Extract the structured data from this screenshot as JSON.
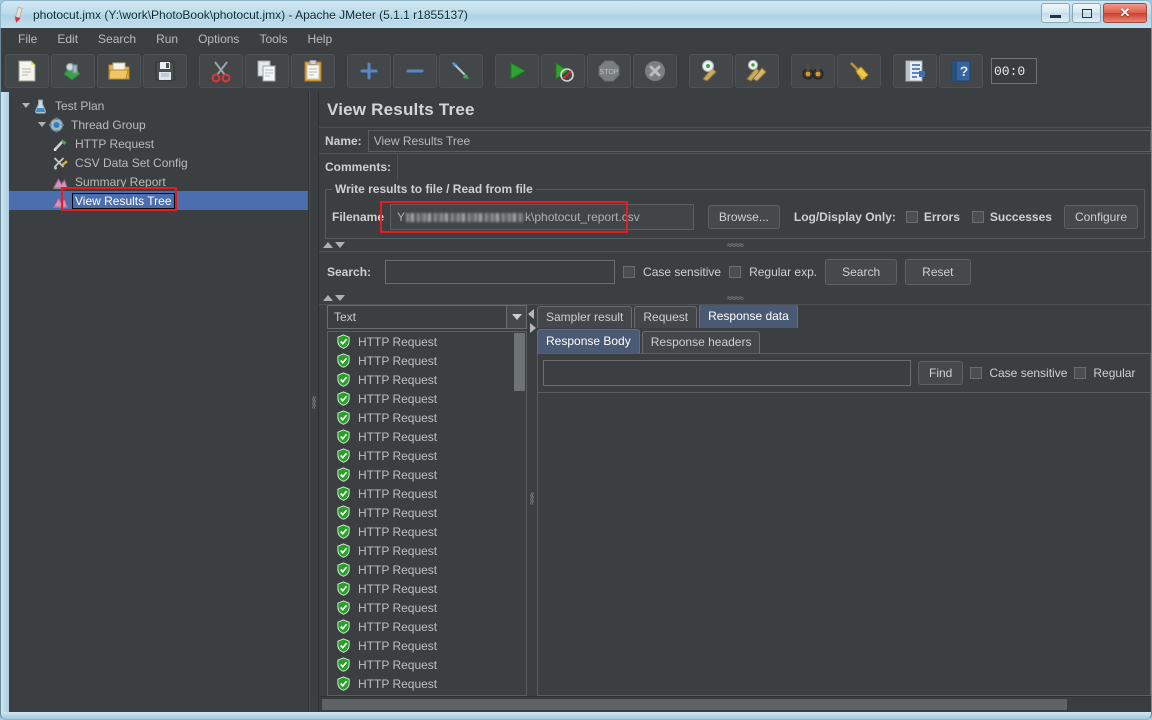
{
  "window": {
    "title": "photocut.jmx (Y:\\work\\PhotoBook\\photocut.jmx) - Apache JMeter (5.1.1 r1855137)",
    "app_icon": "jmeter-feather-icon",
    "minimize_label": "",
    "maximize_label": "",
    "close_label": "✕"
  },
  "menubar": {
    "items": [
      {
        "label": "File"
      },
      {
        "label": "Edit"
      },
      {
        "label": "Search"
      },
      {
        "label": "Run"
      },
      {
        "label": "Options"
      },
      {
        "label": "Tools"
      },
      {
        "label": "Help"
      }
    ]
  },
  "toolbar": {
    "buttons": [
      {
        "icon": "new-document-icon",
        "tooltip": "New"
      },
      {
        "icon": "templates-icon",
        "tooltip": "Templates"
      },
      {
        "icon": "open-folder-icon",
        "tooltip": "Open"
      },
      {
        "icon": "save-floppy-icon",
        "tooltip": "Save"
      },
      {
        "icon": "cut-scissors-icon",
        "tooltip": "Cut"
      },
      {
        "icon": "copy-pages-icon",
        "tooltip": "Copy"
      },
      {
        "icon": "paste-clipboard-icon",
        "tooltip": "Paste"
      },
      {
        "icon": "plus-expand-icon",
        "tooltip": "Expand all"
      },
      {
        "icon": "minus-collapse-icon",
        "tooltip": "Collapse all"
      },
      {
        "icon": "toggle-icon",
        "tooltip": "Toggle"
      },
      {
        "icon": "start-play-icon",
        "tooltip": "Start"
      },
      {
        "icon": "start-no-timers-icon",
        "tooltip": "Start no pauses"
      },
      {
        "icon": "stop-icon",
        "tooltip": "Stop"
      },
      {
        "icon": "shutdown-icon",
        "tooltip": "Shutdown"
      },
      {
        "icon": "clear-icon",
        "tooltip": "Clear"
      },
      {
        "icon": "clear-all-icon",
        "tooltip": "Clear All"
      },
      {
        "icon": "search-binoculars-icon",
        "tooltip": "Search"
      },
      {
        "icon": "reset-broom-icon",
        "tooltip": "Reset Search"
      },
      {
        "icon": "function-helper-icon",
        "tooltip": "Function Helper Dialog"
      },
      {
        "icon": "help-book-icon",
        "tooltip": "Help"
      }
    ],
    "timer_value": "00:0"
  },
  "tree": {
    "nodes": [
      {
        "label": "Test Plan",
        "icon": "test-plan-icon",
        "indent": 1,
        "toggle": "open",
        "selected": false
      },
      {
        "label": "Thread Group",
        "icon": "thread-group-icon",
        "indent": 2,
        "toggle": "open",
        "selected": false
      },
      {
        "label": "HTTP Request",
        "icon": "http-request-icon",
        "indent": 3,
        "toggle": "none",
        "selected": false
      },
      {
        "label": "CSV Data Set Config",
        "icon": "csv-config-icon",
        "indent": 3,
        "toggle": "none",
        "selected": false
      },
      {
        "label": "Summary Report",
        "icon": "listener-icon",
        "indent": 3,
        "toggle": "none",
        "selected": false
      },
      {
        "label": "View Results Tree",
        "icon": "listener-icon",
        "indent": 3,
        "toggle": "none",
        "selected": true
      }
    ]
  },
  "panel": {
    "title": "View Results Tree",
    "name_label": "Name:",
    "name_value": "View Results Tree",
    "comments_label": "Comments:",
    "comments_value": "",
    "file_group": {
      "legend": "Write results to file / Read from file",
      "filename_label": "Filename",
      "filename_prefix": "Y",
      "filename_redacted": true,
      "filename_suffix": "k\\photocut_report.csv",
      "browse_label": "Browse...",
      "log_display_label": "Log/Display Only:",
      "errors_label": "Errors",
      "errors_checked": false,
      "successes_label": "Successes",
      "successes_checked": false,
      "configure_label": "Configure"
    },
    "search": {
      "label": "Search:",
      "value": "",
      "case_sensitive_label": "Case sensitive",
      "case_sensitive_checked": false,
      "regexp_label": "Regular exp.",
      "regexp_checked": false,
      "search_button": "Search",
      "reset_button": "Reset"
    },
    "results": {
      "renderer_selected": "Text",
      "items": [
        {
          "label": "HTTP Request",
          "status": "success"
        },
        {
          "label": "HTTP Request",
          "status": "success"
        },
        {
          "label": "HTTP Request",
          "status": "success"
        },
        {
          "label": "HTTP Request",
          "status": "success"
        },
        {
          "label": "HTTP Request",
          "status": "success"
        },
        {
          "label": "HTTP Request",
          "status": "success"
        },
        {
          "label": "HTTP Request",
          "status": "success"
        },
        {
          "label": "HTTP Request",
          "status": "success"
        },
        {
          "label": "HTTP Request",
          "status": "success"
        },
        {
          "label": "HTTP Request",
          "status": "success"
        },
        {
          "label": "HTTP Request",
          "status": "success"
        },
        {
          "label": "HTTP Request",
          "status": "success"
        },
        {
          "label": "HTTP Request",
          "status": "success"
        },
        {
          "label": "HTTP Request",
          "status": "success"
        },
        {
          "label": "HTTP Request",
          "status": "success"
        },
        {
          "label": "HTTP Request",
          "status": "success"
        },
        {
          "label": "HTTP Request",
          "status": "success"
        },
        {
          "label": "HTTP Request",
          "status": "success"
        },
        {
          "label": "HTTP Request",
          "status": "success"
        }
      ]
    },
    "detail": {
      "tabs": [
        {
          "label": "Sampler result",
          "active": false
        },
        {
          "label": "Request",
          "active": false
        },
        {
          "label": "Response data",
          "active": true
        }
      ],
      "subtabs": [
        {
          "label": "Response Body",
          "active": true
        },
        {
          "label": "Response headers",
          "active": false
        }
      ],
      "find": {
        "value": "",
        "find_button": "Find",
        "case_sensitive_label": "Case sensitive",
        "case_sensitive_checked": false,
        "regexp_label": "Regular",
        "regexp_checked": false
      },
      "body_text": ""
    }
  },
  "colors": {
    "panel_bg": "#3c3f41",
    "selection": "#4b6eaf",
    "active_tab": "#4b5a74",
    "annotation_red": "#e02020",
    "success_green": "#2fa82f"
  }
}
